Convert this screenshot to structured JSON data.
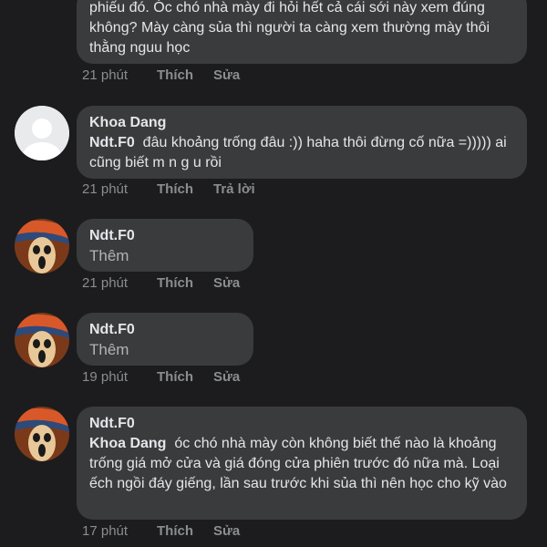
{
  "comments": [
    {
      "text": "phiếu đó. Óc chó nhà mày đi hỏi hết cả cái sới này xem đúng không? Mày càng sủa thì người ta càng xem thường mày thôi thằng nguu học",
      "time": "21 phút",
      "like": "Thích",
      "action": "Sửa"
    },
    {
      "author": "Khoa Dang",
      "tag": "Ndt.F0",
      "text": "đâu khoảng trống đâu :)) haha thôi đừng cố nữa =))))) ai cũng biết m n g u rồi",
      "time": "21 phút",
      "like": "Thích",
      "action": "Trả lời"
    },
    {
      "author": "Ndt.F0",
      "more": "Thêm",
      "time": "21 phút",
      "like": "Thích",
      "action": "Sửa"
    },
    {
      "author": "Ndt.F0",
      "more": "Thêm",
      "time": "19 phút",
      "like": "Thích",
      "action": "Sửa"
    },
    {
      "author": "Ndt.F0",
      "tag": "Khoa Dang",
      "text": "óc chó nhà mày còn không biết thế nào là khoảng trống giá mở cửa và giá đóng cửa phiên trước đó nữa mà. Loại ếch ngồi đáy giếng, lần sau trước khi sủa thì nên học cho kỹ vào",
      "time": "17 phút",
      "like": "Thích",
      "action": "Sửa"
    }
  ]
}
